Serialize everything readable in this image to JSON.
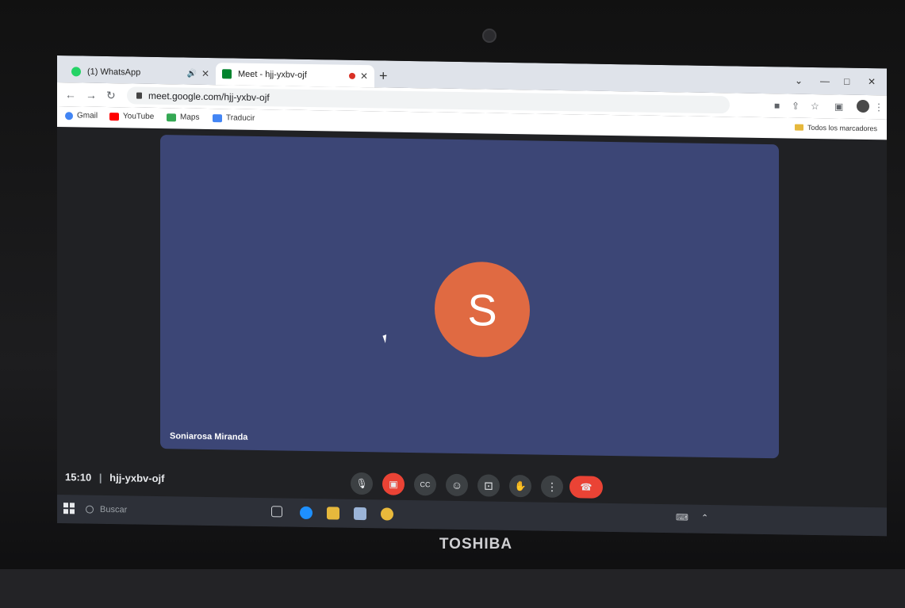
{
  "browser": {
    "tabs": [
      {
        "label": "(1) WhatsApp",
        "favicon_color": "#25d366",
        "audio": true,
        "active": false
      },
      {
        "label": "Meet - hjj-yxbv-ojf",
        "favicon_color": "#00832d",
        "recording": true,
        "active": true
      }
    ],
    "new_tab_symbol": "+",
    "url": "meet.google.com/hjj-yxbv-ojf",
    "bookmarks": [
      {
        "label": "Gmail",
        "icon": "google-icon",
        "color": "#4285f4"
      },
      {
        "label": "YouTube",
        "icon": "youtube-icon",
        "color": "#ff0000"
      },
      {
        "label": "Maps",
        "icon": "maps-icon",
        "color": "#34a853"
      },
      {
        "label": "Traducir",
        "icon": "translate-icon",
        "color": "#4285f4"
      }
    ],
    "all_bookmarks": "Todos los marcadores",
    "window_controls": {
      "chevron": "⌄",
      "minimize": "—",
      "maximize": "□",
      "close": "✕"
    }
  },
  "meet": {
    "participant_initial": "S",
    "participant_name": "Soniarosa Miranda",
    "avatar_color": "#e06a42",
    "time": "15:10",
    "meeting_code": "hjj-yxbv-ojf",
    "separator": "|",
    "controls": [
      {
        "name": "mic-button",
        "icon": "mic-icon",
        "glyph": "🎙"
      },
      {
        "name": "camera-off-button",
        "icon": "camera-off-icon",
        "glyph": "▣",
        "state": "off"
      },
      {
        "name": "captions-button",
        "icon": "captions-icon",
        "glyph": "CC"
      },
      {
        "name": "emoji-button",
        "icon": "emoji-icon",
        "glyph": "☺"
      },
      {
        "name": "present-button",
        "icon": "present-icon",
        "glyph": "⊡"
      },
      {
        "name": "raise-hand-button",
        "icon": "hand-icon",
        "glyph": "✋"
      },
      {
        "name": "more-options-button",
        "icon": "more-vert-icon",
        "glyph": "⋮"
      },
      {
        "name": "leave-call-button",
        "icon": "end-call-icon",
        "glyph": "☎"
      }
    ]
  },
  "taskbar": {
    "search_placeholder": "Buscar",
    "apps": [
      {
        "name": "task-view",
        "icon": "task-view-icon",
        "color": "#cfd2d6"
      },
      {
        "name": "edge",
        "icon": "edge-icon",
        "color": "#1e90ff"
      },
      {
        "name": "file-explorer",
        "icon": "folder-icon",
        "color": "#e6b83c"
      },
      {
        "name": "mail",
        "icon": "mail-icon",
        "color": "#9bb4d8"
      },
      {
        "name": "chrome",
        "icon": "chrome-icon",
        "color": "#e9b93b"
      }
    ]
  },
  "device": {
    "brand": "TOSHIBA"
  }
}
